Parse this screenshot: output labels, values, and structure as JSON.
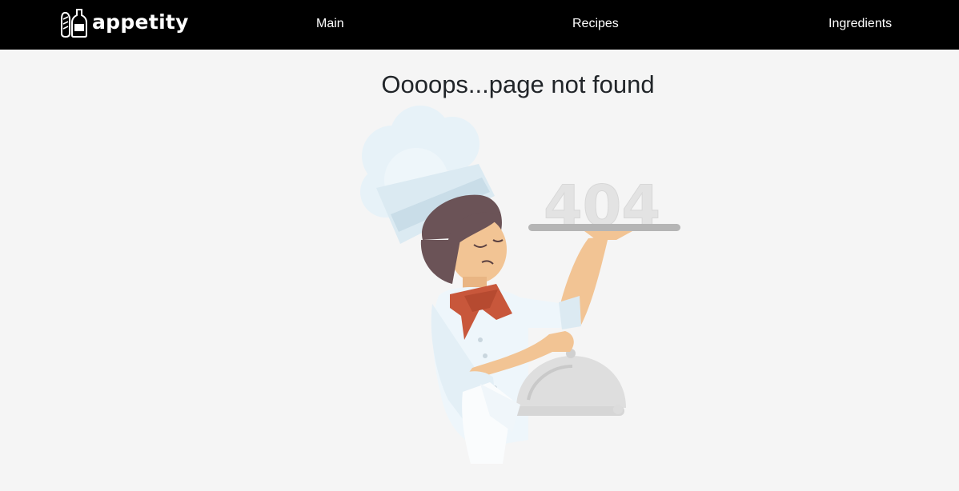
{
  "navbar": {
    "logo_text": "appetity",
    "links": [
      {
        "label": "Main"
      },
      {
        "label": "Recipes"
      },
      {
        "label": "Ingredients"
      }
    ]
  },
  "main": {
    "title": "Oooops...page not found",
    "illustration_text": "404"
  },
  "colors": {
    "navbar_bg": "#000000",
    "page_bg": "#f5f5f5",
    "title_text": "#212529",
    "scarf": "#c8573b",
    "skin": "#f2c494",
    "hair": "#6b5357"
  }
}
